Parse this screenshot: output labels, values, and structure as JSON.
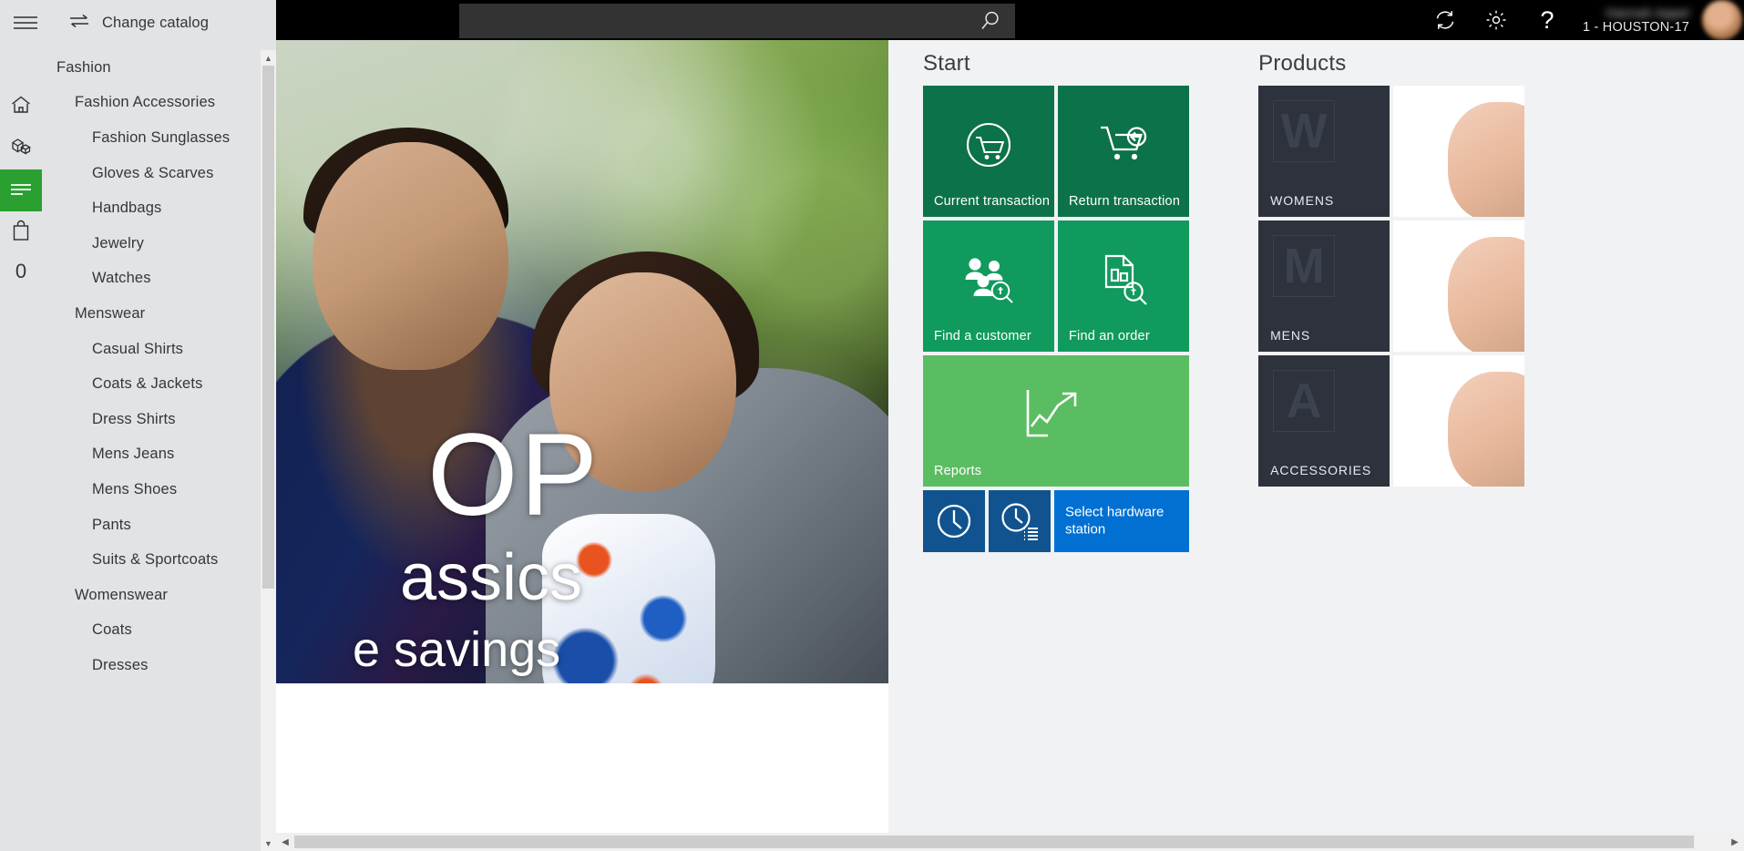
{
  "topbar": {
    "search": {
      "value": "",
      "placeholder": ""
    },
    "search_icon": "search-icon",
    "refresh_icon": "refresh-icon",
    "settings_icon": "gear-icon",
    "help_icon": "question-mark-icon",
    "user_name": "Hannah Appel",
    "user_station": "1 - HOUSTON-17"
  },
  "sidebar": {
    "menu_icon": "hamburger-menu-icon",
    "change_catalog_label": "Change catalog",
    "change_catalog_icon": "swap-arrows-icon",
    "rail": [
      {
        "name": "home-icon",
        "active": false
      },
      {
        "name": "products-boxes-icon",
        "active": false
      },
      {
        "name": "catalog-lines-icon",
        "active": true
      },
      {
        "name": "shopping-bag-icon",
        "active": false
      }
    ],
    "cart_count": "0",
    "catalog": [
      {
        "label": "Fashion",
        "level": 0
      },
      {
        "label": "Fashion Accessories",
        "level": 1
      },
      {
        "label": "Fashion Sunglasses",
        "level": 2
      },
      {
        "label": "Gloves & Scarves",
        "level": 2
      },
      {
        "label": "Handbags",
        "level": 2
      },
      {
        "label": "Jewelry",
        "level": 2
      },
      {
        "label": "Watches",
        "level": 2
      },
      {
        "label": "Menswear",
        "level": 1
      },
      {
        "label": "Casual Shirts",
        "level": 2
      },
      {
        "label": "Coats & Jackets",
        "level": 2
      },
      {
        "label": "Dress Shirts",
        "level": 2
      },
      {
        "label": "Mens Jeans",
        "level": 2
      },
      {
        "label": "Mens Shoes",
        "level": 2
      },
      {
        "label": "Pants",
        "level": 2
      },
      {
        "label": "Suits & Sportcoats",
        "level": 2
      },
      {
        "label": "Womenswear",
        "level": 1
      },
      {
        "label": "Coats",
        "level": 2
      },
      {
        "label": "Dresses",
        "level": 2
      }
    ]
  },
  "hero": {
    "line1": "OP",
    "line2": "assics",
    "line3": "e savings"
  },
  "start": {
    "title": "Start",
    "tiles": [
      {
        "label": "Current transaction",
        "icon": "shopping-cart-circle-icon",
        "color": "#0c7249",
        "size": "sq"
      },
      {
        "label": "Return transaction",
        "icon": "return-cart-icon",
        "color": "#0c7249",
        "size": "sq"
      },
      {
        "label": "Find a customer",
        "icon": "people-search-icon",
        "color": "#119a5d",
        "size": "sq"
      },
      {
        "label": "Find an order",
        "icon": "document-search-icon",
        "color": "#119a5d",
        "size": "sq"
      },
      {
        "label": "Reports",
        "icon": "chart-arrow-up-icon",
        "color": "#5bbd62",
        "size": "wide"
      }
    ],
    "small_tiles": [
      {
        "label": "",
        "icon": "clock-icon",
        "color": "#10538f",
        "size": "small"
      },
      {
        "label": "",
        "icon": "clock-list-icon",
        "color": "#10538f",
        "size": "small"
      },
      {
        "label": "Select hardware station",
        "icon": "",
        "color": "#0270d3",
        "size": "small-wide"
      }
    ]
  },
  "products": {
    "title": "Products",
    "tiles": [
      {
        "letter": "W",
        "label": "WOMENS"
      },
      {
        "letter": "M",
        "label": "MENS"
      },
      {
        "letter": "A",
        "label": "ACCESSORIES"
      }
    ]
  },
  "scrollbars": {
    "up_arrow": "▲",
    "down_arrow": "▼",
    "left_arrow": "◀",
    "right_arrow": "▶"
  }
}
